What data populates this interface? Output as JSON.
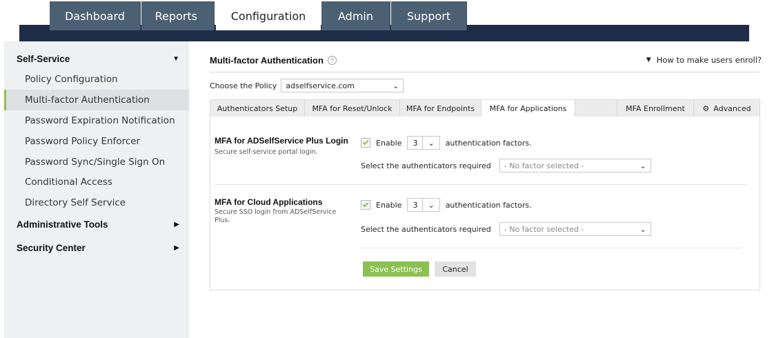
{
  "nav": {
    "tabs": [
      {
        "label": "Dashboard"
      },
      {
        "label": "Reports"
      },
      {
        "label": "Configuration"
      },
      {
        "label": "Admin"
      },
      {
        "label": "Support"
      }
    ],
    "active": "Configuration"
  },
  "sidebar": {
    "sections": [
      {
        "label": "Self-Service",
        "arrow": "▼"
      },
      {
        "label": "Administrative Tools",
        "arrow": "▶"
      },
      {
        "label": "Security Center",
        "arrow": "▶"
      }
    ],
    "items": [
      {
        "label": "Policy Configuration"
      },
      {
        "label": "Multi-factor Authentication"
      },
      {
        "label": "Password Expiration Notification"
      },
      {
        "label": "Password Policy Enforcer"
      },
      {
        "label": "Password Sync/Single Sign On"
      },
      {
        "label": "Conditional Access"
      },
      {
        "label": "Directory Self Service"
      }
    ]
  },
  "main": {
    "title": "Multi-factor Authentication",
    "help": "?",
    "enroll_link": "How to make users enroll?",
    "policy_label": "Choose the Policy",
    "policy_value": "adselfservice.com",
    "tabs": [
      {
        "label": "Authenticators Setup"
      },
      {
        "label": "MFA for Reset/Unlock"
      },
      {
        "label": "MFA for Endpoints"
      },
      {
        "label": "MFA for Applications"
      },
      {
        "label": "MFA Enrollment"
      },
      {
        "label": "Advanced"
      }
    ],
    "sections": [
      {
        "title": "MFA for ADSelfService Plus Login",
        "desc": "Secure self-service portal login.",
        "enable_label": "Enable",
        "factor_count": "3",
        "factors_suffix": "authentication factors.",
        "auth_label": "Select the authenticators required",
        "auth_placeholder": "- No factor selected -"
      },
      {
        "title": "MFA for Cloud Applications",
        "desc": "Secure SSO login from ADSelfService Plus.",
        "enable_label": "Enable",
        "factor_count": "3",
        "factors_suffix": "authentication factors.",
        "auth_label": "Select the authenticators required",
        "auth_placeholder": "- No factor selected -"
      }
    ],
    "save_label": "Save Settings",
    "cancel_label": "Cancel"
  },
  "colors": {
    "navbar": "#1f2d48",
    "tab": "#4b6072",
    "accent_green": "#8cc152",
    "sidebar_bg": "#eef0f1"
  }
}
